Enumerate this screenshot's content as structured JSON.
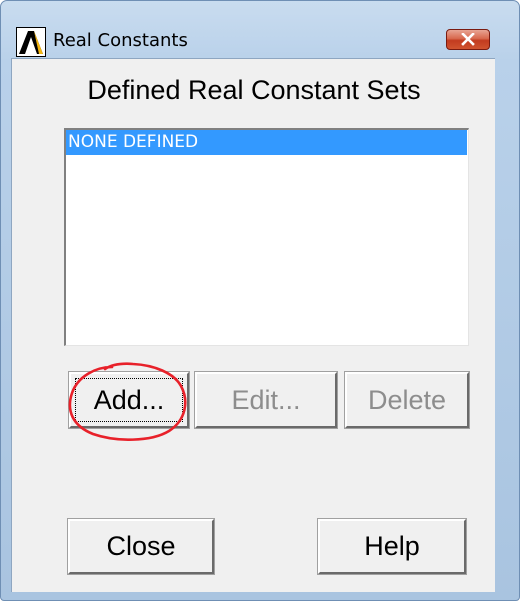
{
  "window": {
    "title": "Real Constants",
    "logo_icon": "ansys-logo-icon",
    "close_icon": "close-icon"
  },
  "dialog": {
    "heading": "Defined Real Constant Sets",
    "list": {
      "items": [
        "NONE DEFINED"
      ],
      "selected_index": 0
    },
    "buttons": {
      "add": "Add...",
      "edit": "Edit...",
      "delete": "Delete",
      "close": "Close",
      "help": "Help"
    }
  },
  "annotation": {
    "shape": "ellipse",
    "color": "#e8212a",
    "target": "add-button"
  },
  "colors": {
    "selection": "#3399ff",
    "close_button": "#c9452a",
    "dialog_background": "#f0f0f0",
    "frame": "#b9d1ea"
  }
}
